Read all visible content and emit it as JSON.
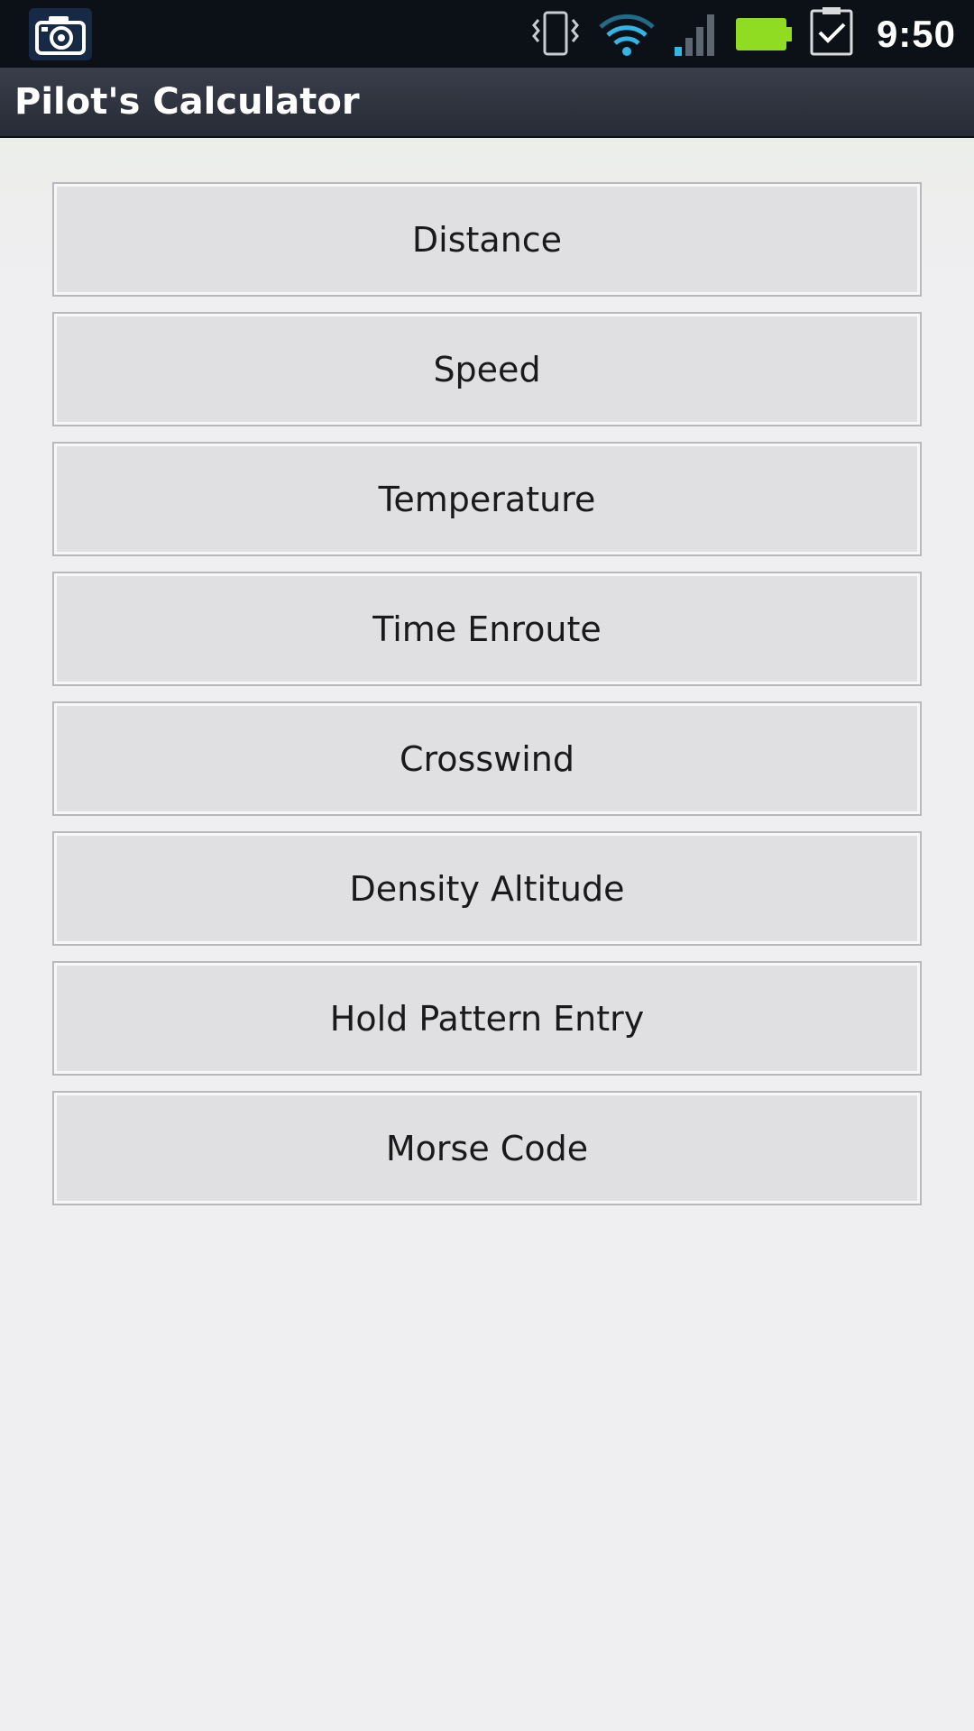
{
  "status_bar": {
    "time": "9:50",
    "icons": [
      "camera-icon",
      "vibrate-icon",
      "wifi-icon",
      "signal-icon",
      "battery-icon",
      "task-icon"
    ],
    "colors": {
      "battery": "#8fdc22",
      "wifi": "#33b5e5",
      "signal": "#33b5e5"
    }
  },
  "app_bar": {
    "title": "Pilot's Calculator"
  },
  "menu": {
    "items": [
      {
        "label": "Distance"
      },
      {
        "label": "Speed"
      },
      {
        "label": "Temperature"
      },
      {
        "label": "Time Enroute"
      },
      {
        "label": "Crosswind"
      },
      {
        "label": "Density Altitude"
      },
      {
        "label": "Hold Pattern Entry"
      },
      {
        "label": "Morse Code"
      }
    ]
  }
}
